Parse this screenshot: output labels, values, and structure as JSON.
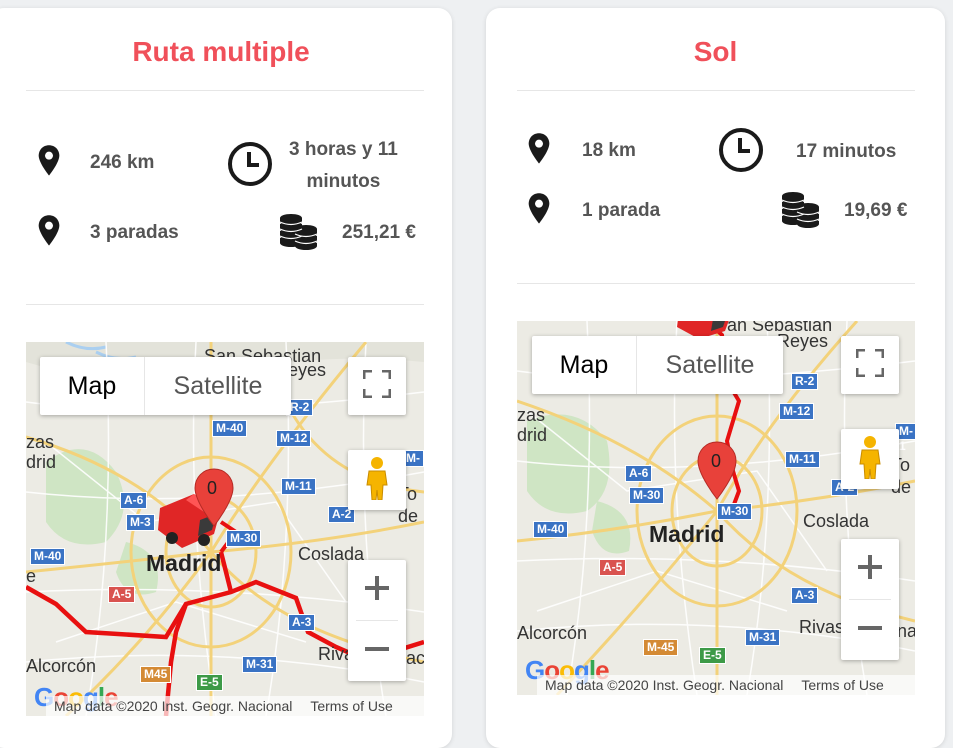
{
  "cards": [
    {
      "title": "Ruta multiple",
      "distance": "246 km",
      "duration_line1": "3 horas y 11",
      "duration_line2": "minutos",
      "stops": "3 paradas",
      "cost": "251,21 €",
      "map": {
        "type_map": "Map",
        "type_satellite": "Satellite",
        "marker_label": "0",
        "labels": {
          "sansebastian": "San Sebastian",
          "reyes": "eyes",
          "zas": "zas",
          "drid": "drid",
          "madrid": "Madrid",
          "coslada": "Coslada",
          "alcorcon": "Alcorcón",
          "rivas": "Rivas-",
          "tol": "To",
          "de": "de",
          "e": "e",
          "rivas_tail": "ac"
        },
        "shields": [
          "R-2",
          "M-40",
          "M-12",
          "M-11",
          "A-6",
          "M-3",
          "M-30",
          "A-2",
          "M-40",
          "A-5",
          "A-3",
          "M-31",
          "M45",
          "E-5",
          "M-"
        ],
        "attribution": "Map data ©2020 Inst. Geogr. Nacional",
        "terms": "Terms of Use",
        "google": "Google"
      }
    },
    {
      "title": "Sol",
      "distance": "18 km",
      "duration": "17 minutos",
      "stops": "1 parada",
      "cost": "19,69 €",
      "map": {
        "type_map": "Map",
        "type_satellite": "Satellite",
        "marker_label": "0",
        "labels": {
          "sansebastian": "an Sebastian",
          "reyes": "Reyes",
          "zas": "zas",
          "drid": "drid",
          "madrid": "Madrid",
          "coslada": "Coslada",
          "alcorcon": "Alcorcón",
          "rivas": "Rivas",
          "to": "To",
          "de": "de",
          "rivas_tail": "na"
        },
        "shields": [
          "R-2",
          "M-12",
          "M-11",
          "A-6",
          "M-30",
          "A-2",
          "M-30",
          "M-40",
          "A-5",
          "A-3",
          "M-31",
          "M-45",
          "E-5",
          "M-1"
        ],
        "attribution": "Map data ©2020 Inst. Geogr. Nacional",
        "terms": "Terms of Use",
        "google": "Google"
      }
    }
  ],
  "colors": {
    "accent": "#f0505a",
    "route": "#e81010",
    "text": "#555555"
  }
}
